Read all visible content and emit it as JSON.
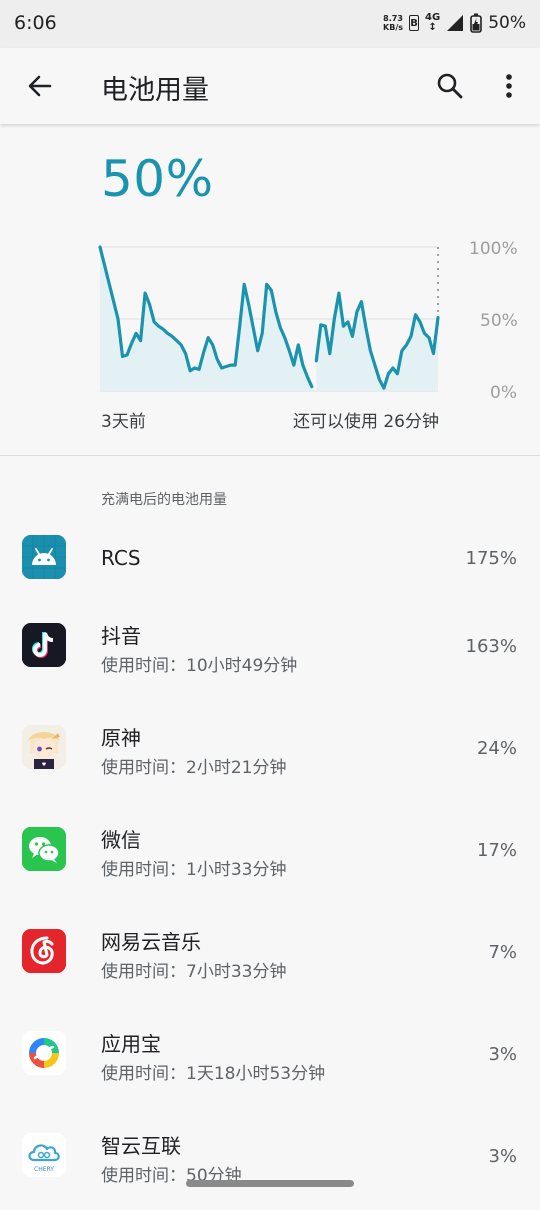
{
  "status_bar": {
    "time": "6:06",
    "net_speed_value": "8.73",
    "net_speed_unit": "KB/s",
    "b_badge": "B",
    "network": "4G",
    "battery": "50%"
  },
  "app_bar": {
    "title": "电池用量",
    "icons": [
      "back-arrow-icon",
      "search-icon",
      "more-vert-icon"
    ]
  },
  "battery": {
    "level": "50%",
    "accent_color": "#1a93ae"
  },
  "chart_data": {
    "type": "line",
    "y_tick_labels": [
      "100%",
      "50%",
      "0%"
    ],
    "x_left_label": "3天前",
    "x_right_label": "还可以使用 26分钟",
    "ylim": [
      0,
      100
    ],
    "grid": true,
    "segments": [
      [
        [
          0,
          100
        ],
        [
          4,
          50
        ],
        [
          5,
          24
        ],
        [
          6,
          25
        ],
        [
          7,
          33
        ],
        [
          8,
          40
        ],
        [
          9,
          35
        ],
        [
          10,
          68
        ],
        [
          11,
          60
        ],
        [
          12,
          48
        ],
        [
          13,
          45
        ],
        [
          14,
          43
        ],
        [
          15,
          40
        ],
        [
          16,
          38
        ],
        [
          17,
          35
        ],
        [
          18,
          32
        ],
        [
          19,
          26
        ],
        [
          20,
          14
        ],
        [
          21,
          16
        ],
        [
          22,
          15
        ],
        [
          23,
          27
        ],
        [
          24,
          37
        ],
        [
          25,
          32
        ],
        [
          26,
          22
        ],
        [
          27,
          16
        ],
        [
          28,
          17
        ],
        [
          29,
          18
        ],
        [
          30,
          18
        ],
        [
          31,
          45
        ],
        [
          32,
          74
        ],
        [
          33,
          60
        ],
        [
          34,
          44
        ],
        [
          35,
          28
        ],
        [
          36,
          40
        ],
        [
          37,
          74
        ],
        [
          38,
          70
        ],
        [
          39,
          55
        ],
        [
          40,
          44
        ],
        [
          41,
          37
        ],
        [
          42,
          28
        ],
        [
          43,
          18
        ],
        [
          44,
          32
        ],
        [
          45,
          18
        ],
        [
          46,
          10
        ],
        [
          47,
          3
        ]
      ],
      [
        [
          48,
          21
        ],
        [
          49,
          46
        ],
        [
          50,
          45
        ],
        [
          51,
          26
        ],
        [
          52,
          50
        ],
        [
          53,
          68
        ],
        [
          54,
          45
        ],
        [
          55,
          48
        ],
        [
          56,
          38
        ],
        [
          57,
          55
        ],
        [
          58,
          62
        ],
        [
          59,
          44
        ],
        [
          60,
          28
        ],
        [
          61,
          18
        ],
        [
          62,
          8
        ],
        [
          63,
          2
        ],
        [
          64,
          12
        ],
        [
          65,
          16
        ],
        [
          66,
          12
        ],
        [
          67,
          28
        ],
        [
          68,
          32
        ],
        [
          69,
          38
        ],
        [
          70,
          53
        ],
        [
          71,
          48
        ],
        [
          72,
          40
        ],
        [
          73,
          37
        ],
        [
          74,
          26
        ],
        [
          75,
          51
        ]
      ]
    ]
  },
  "section_header": "充满电后的电池用量",
  "apps": [
    {
      "name": "RCS",
      "usage": "",
      "percent": "175%",
      "icon": "android-icon"
    },
    {
      "name": "抖音",
      "usage": "使用时间：10小时49分钟",
      "percent": "163%",
      "icon": "douyin-icon"
    },
    {
      "name": "原神",
      "usage": "使用时间：2小时21分钟",
      "percent": "24%",
      "icon": "genshin-icon"
    },
    {
      "name": "微信",
      "usage": "使用时间：1小时33分钟",
      "percent": "17%",
      "icon": "wechat-icon"
    },
    {
      "name": "网易云音乐",
      "usage": "使用时间：7小时33分钟",
      "percent": "7%",
      "icon": "netease-music-icon"
    },
    {
      "name": "应用宝",
      "usage": "使用时间：1天18小时53分钟",
      "percent": "3%",
      "icon": "yingyongbao-icon"
    },
    {
      "name": "智云互联",
      "usage": "使用时间：50分钟",
      "percent": "3%",
      "icon": "zhiyun-cloud-icon",
      "icon_text": "CHERY"
    }
  ]
}
